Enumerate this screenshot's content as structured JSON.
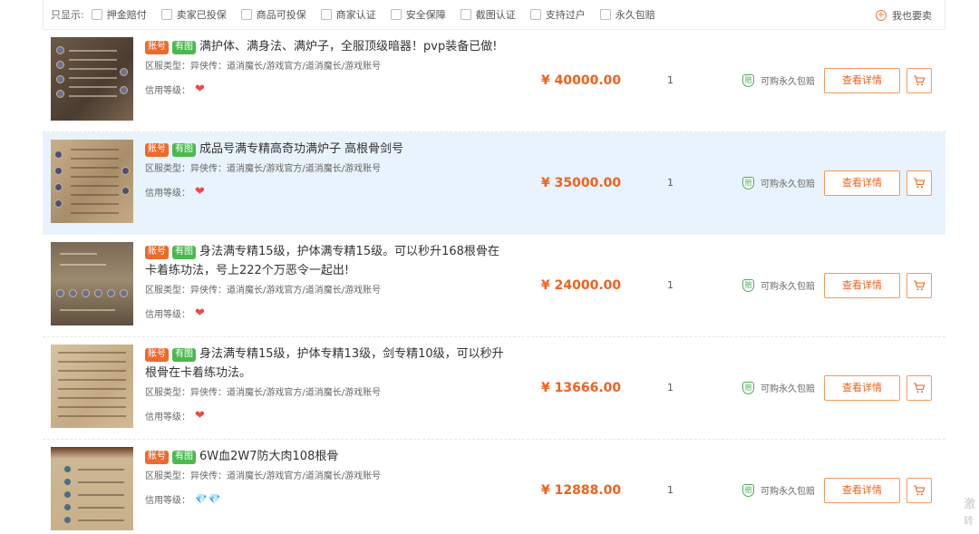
{
  "filters": {
    "label": "只显示:",
    "options": [
      "押金赔付",
      "卖家已投保",
      "商品可投保",
      "商家认证",
      "安全保障",
      "截图认证",
      "支持过户",
      "永久包赔"
    ],
    "want_sell": "我也要卖"
  },
  "listings": [
    {
      "tag_account": "账号",
      "tag_image": "有图",
      "title": "满护体、满身法、满炉子，全服顶级暗器！pvp装备已做!",
      "server": "区服类型：异侠传：道消魔长/游戏官方/道消魔长/游戏账号",
      "credit_label": "信用等级：",
      "credit_icon": "❤",
      "price": "¥ 40000.00",
      "qty": "1",
      "guarantee": "可购永久包赔",
      "detail": "查看详情"
    },
    {
      "tag_account": "账号",
      "tag_image": "有图",
      "title": "成品号满专精高奇功满炉子 高根骨剑号",
      "server": "区服类型：异侠传：道消魔长/游戏官方/道消魔长/游戏账号",
      "credit_label": "信用等级：",
      "credit_icon": "❤",
      "price": "¥ 35000.00",
      "qty": "1",
      "guarantee": "可购永久包赔",
      "detail": "查看详情"
    },
    {
      "tag_account": "账号",
      "tag_image": "有图",
      "title": "身法满专精15级，护体满专精15级。可以秒升168根骨在卡着练功法，号上222个万恶令一起出!",
      "server": "区服类型：异侠传：道消魔长/游戏官方/道消魔长/游戏账号",
      "credit_label": "信用等级：",
      "credit_icon": "❤",
      "price": "¥ 24000.00",
      "qty": "1",
      "guarantee": "可购永久包赔",
      "detail": "查看详情"
    },
    {
      "tag_account": "账号",
      "tag_image": "有图",
      "title": "身法满专精15级，护体专精13级，剑专精10级，可以秒升根骨在卡着练功法。",
      "server": "区服类型：异侠传：道消魔长/游戏官方/道消魔长/游戏账号",
      "credit_label": "信用等级：",
      "credit_icon": "❤",
      "price": "¥ 13666.00",
      "qty": "1",
      "guarantee": "可购永久包赔",
      "detail": "查看详情"
    },
    {
      "tag_account": "账号",
      "tag_image": "有图",
      "title": "6W血2W7防大肉108根骨",
      "server": "区服类型：异侠传：道消魔长/游戏官方/道消魔长/游戏账号",
      "credit_label": "信用等级：",
      "credit_icon": "💎💎",
      "price": "¥ 12888.00",
      "qty": "1",
      "guarantee": "可购永久包赔",
      "detail": "查看详情"
    }
  ],
  "watermark": {
    "line1": "激",
    "line2": "转"
  },
  "colors": {
    "accent": "#f0621d",
    "tag_account": "#ee6a2c",
    "tag_image": "#4cb84f",
    "highlight_row": "#e8f3fd"
  }
}
